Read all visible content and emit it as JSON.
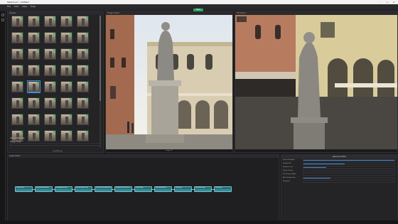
{
  "window": {
    "title": "Meshroom - Untitled",
    "minimize": "–",
    "maximize": "□",
    "close": "✕"
  },
  "menu": [
    "File",
    "Edit",
    "View",
    "Help"
  ],
  "toolbar": {
    "start_label": "Start"
  },
  "images_panel": {
    "title": "Images",
    "thumbnail_count": 40,
    "selected_index": 21,
    "status_ok_color": "#3fbf6f",
    "image_count_label": "40 images"
  },
  "image_settings": {
    "section_label": "Image Metadata",
    "field_label": "Image Folder",
    "field_value": "",
    "button_label": "+"
  },
  "viewer_2d": {
    "title": "Image Viewer",
    "footer": "Image 22"
  },
  "viewer_3d": {
    "title": "3D Viewer"
  },
  "graph_editor": {
    "title": "Graph Editor",
    "nodes": [
      "CameraInit",
      "FeatureExtraction",
      "ImageMatching",
      "FeatureMatching",
      "StructureFromMotion",
      "PrepareDenseScene",
      "DepthMap",
      "DepthMapFilter",
      "Meshing",
      "MeshFiltering",
      "Texturing"
    ],
    "node_color": "#3b8a97"
  },
  "attribute_editor": {
    "title": "Attribute Editor",
    "rows": [
      {
        "label": "Sensor Database",
        "fill": 1.0
      },
      {
        "label": "Default FoV",
        "fill": 0.45
      },
      {
        "label": "Verbose Level",
        "fill": 0.25
      },
      {
        "label": "Group Camera",
        "fill": 0.0
      },
      {
        "label": "Use Internal White",
        "fill": 0.0
      },
      {
        "label": "Allow Single View",
        "fill": 0.3
      },
      {
        "label": "Viewpoint",
        "fill": 0.0
      }
    ],
    "accent": "#3a7fc0"
  }
}
